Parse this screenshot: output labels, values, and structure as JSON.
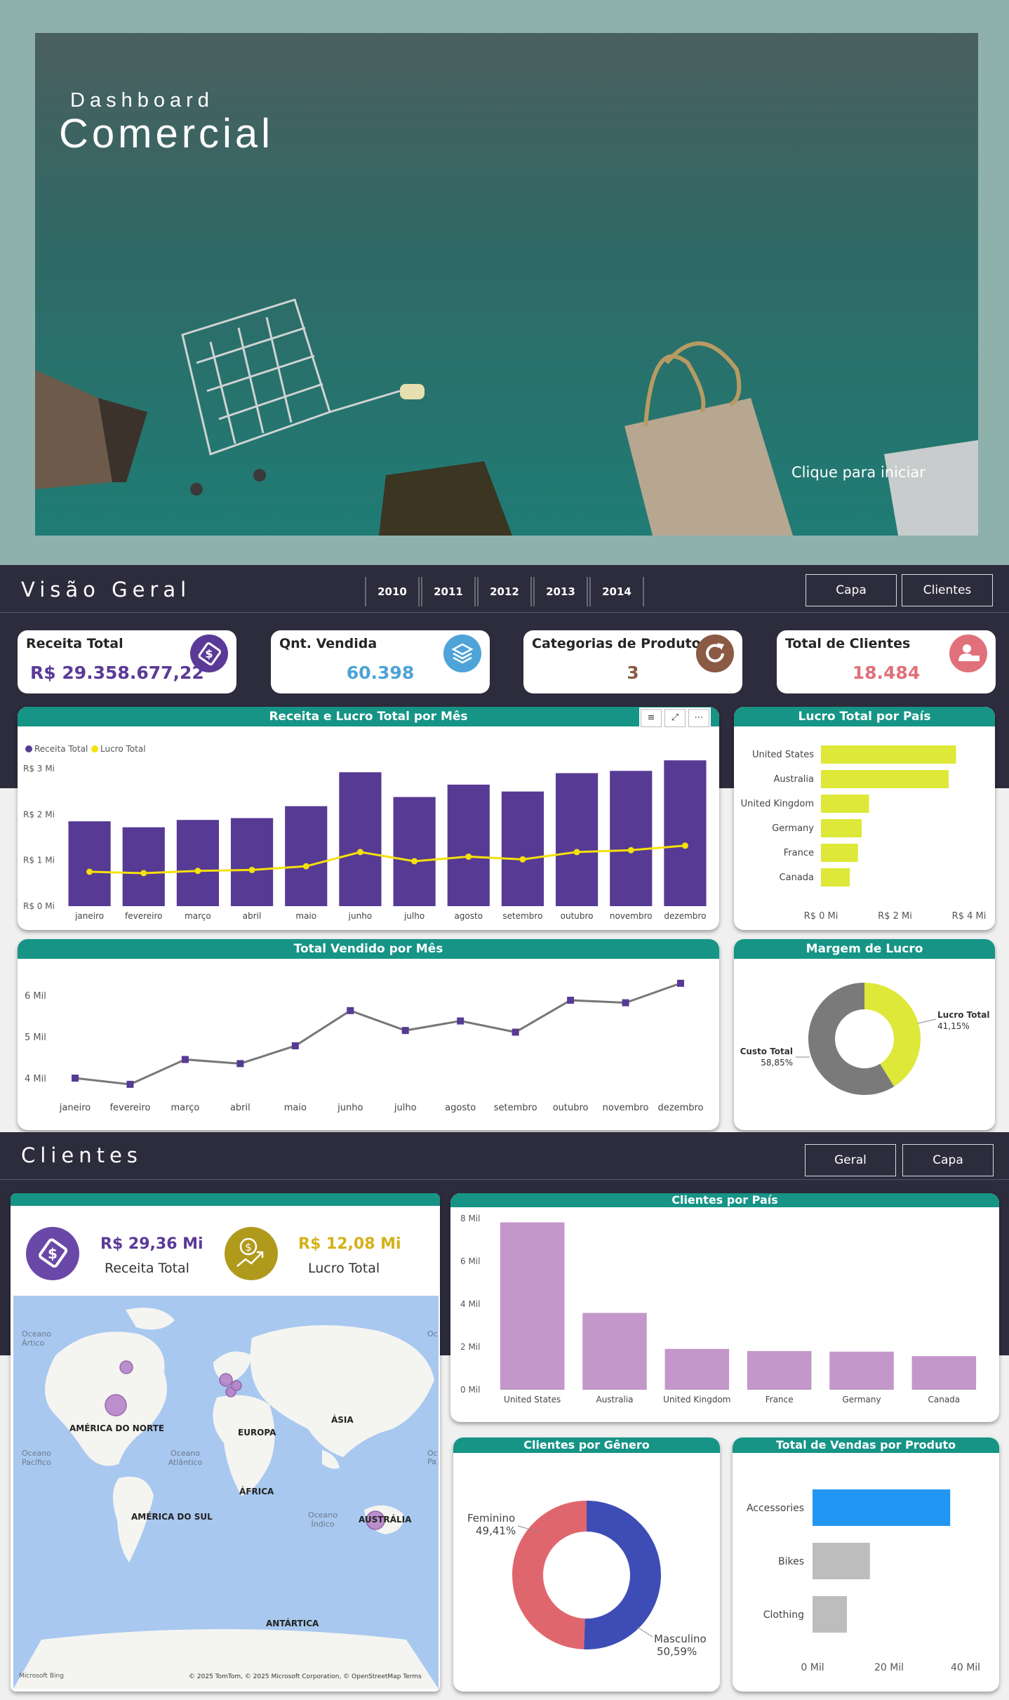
{
  "cover": {
    "subtitle": "Dashboard",
    "title": "Comercial",
    "start_label": "Clique para iniciar"
  },
  "overview": {
    "title": "Visão Geral",
    "years": [
      "2010",
      "2011",
      "2012",
      "2013",
      "2014"
    ],
    "nav": {
      "capa": "Capa",
      "clientes": "Clientes"
    },
    "kpis": [
      {
        "label": "Receita Total",
        "value": "R$ 29.358.677,22",
        "color": "#5b3a97",
        "icon": "money-tag-icon"
      },
      {
        "label": "Qnt. Vendida",
        "value": "60.398",
        "color": "#4ea3d8",
        "icon": "layers-icon"
      },
      {
        "label": "Categorias de Produto",
        "value": "3",
        "color": "#8a5a44",
        "icon": "refresh-icon"
      },
      {
        "label": "Total de Clientes",
        "value": "18.484",
        "color": "#e0707a",
        "icon": "user-icon"
      }
    ]
  },
  "customers_page": {
    "title": "Clientes",
    "nav": {
      "geral": "Geral",
      "capa": "Capa"
    },
    "revenue": {
      "value": "R$ 29,36 Mi",
      "label": "Receita Total"
    },
    "profit": {
      "value": "R$ 12,08 Mi",
      "label": "Lucro Total"
    },
    "map": {
      "labels": [
        "Oceano Ártico",
        "AMÉRICA DO NORTE",
        "EUROPA",
        "ÁSIA",
        "Oceano Pacífico",
        "Oceano Atlântico",
        "ÁFRICA",
        "AMÉRICA DO SUL",
        "Oceano Índico",
        "AUSTRÁLIA",
        "ANTÁRTICA",
        "Oc",
        "Oc",
        "Pa"
      ],
      "credit": "© 2025 TomTom, © 2025 Microsoft Corporation, © OpenStreetMap  Terms",
      "bing": "Microsoft Bing"
    }
  },
  "chart_data": [
    {
      "type": "bar",
      "title": "Receita e Lucro Total por Mês",
      "legend": [
        "Receita Total",
        "Lucro Total"
      ],
      "categories": [
        "janeiro",
        "fevereiro",
        "março",
        "abril",
        "maio",
        "junho",
        "julho",
        "agosto",
        "setembro",
        "outubro",
        "novembro",
        "dezembro"
      ],
      "series": [
        {
          "name": "Receita Total",
          "type": "bar",
          "color": "#573a94",
          "values": [
            1.85,
            1.72,
            1.88,
            1.92,
            2.18,
            2.92,
            2.38,
            2.65,
            2.5,
            2.9,
            2.95,
            3.18
          ]
        },
        {
          "name": "Lucro Total",
          "type": "line",
          "color": "#f4e10a",
          "values": [
            0.75,
            0.72,
            0.77,
            0.79,
            0.87,
            1.18,
            0.98,
            1.08,
            1.02,
            1.18,
            1.22,
            1.32
          ]
        }
      ],
      "yticks": [
        "R$ 0 Mi",
        "R$ 1 Mi",
        "R$ 2 Mi",
        "R$ 3 Mi"
      ],
      "ylim": [
        0,
        3
      ]
    },
    {
      "type": "bar",
      "title": "Lucro Total por País",
      "categories": [
        "United States",
        "Australia",
        "United Kingdom",
        "Germany",
        "France",
        "Canada"
      ],
      "values": [
        3.65,
        3.45,
        1.3,
        1.1,
        1.0,
        0.78
      ],
      "color": "#dde838",
      "xticks": [
        "R$ 0 Mi",
        "R$ 2 Mi",
        "R$ 4 Mi"
      ],
      "xlim": [
        0,
        4
      ]
    },
    {
      "type": "line",
      "title": "Total Vendido por Mês",
      "categories": [
        "janeiro",
        "fevereiro",
        "março",
        "abril",
        "maio",
        "junho",
        "julho",
        "agosto",
        "setembro",
        "outubro",
        "novembro",
        "dezembro"
      ],
      "values": [
        4000,
        3850,
        4450,
        4350,
        4780,
        5630,
        5150,
        5380,
        5110,
        5880,
        5820,
        6290
      ],
      "yticks": [
        "4 Mil",
        "5 Mil",
        "6 Mil"
      ],
      "ylim": [
        4000,
        6000
      ]
    },
    {
      "type": "pie",
      "title": "Margem de Lucro",
      "slices": [
        {
          "label": "Lucro Total",
          "pct": "41,15%",
          "value": 41.15,
          "color": "#dde838"
        },
        {
          "label": "Custo Total",
          "pct": "58,85%",
          "value": 58.85,
          "color": "#7a7a7a"
        }
      ]
    },
    {
      "type": "bar",
      "title": "Clientes por País",
      "categories": [
        "United States",
        "Australia",
        "United Kingdom",
        "France",
        "Germany",
        "Canada"
      ],
      "values": [
        7820,
        3590,
        1910,
        1810,
        1780,
        1570
      ],
      "color": "#c397c9",
      "yticks": [
        "0 Mil",
        "2 Mil",
        "4 Mil",
        "6 Mil",
        "8 Mil"
      ],
      "ylim": [
        0,
        8000
      ]
    },
    {
      "type": "pie",
      "title": "Clientes por Gênero",
      "slices": [
        {
          "label": "Masculino",
          "pct": "50,59%",
          "value": 50.59,
          "color": "#3e4db6"
        },
        {
          "label": "Feminino",
          "pct": "49,41%",
          "value": 49.41,
          "color": "#e0666e"
        }
      ]
    },
    {
      "type": "bar",
      "title": "Total de Vendas por Produto",
      "categories": [
        "Accessories",
        "Bikes",
        "Clothing"
      ],
      "values": [
        36,
        15,
        9
      ],
      "colors": [
        "#2196f3",
        "#bdbdbd",
        "#bdbdbd"
      ],
      "xticks": [
        "0 Mil",
        "20 Mil",
        "40 Mil"
      ],
      "xlim": [
        0,
        40
      ]
    }
  ]
}
